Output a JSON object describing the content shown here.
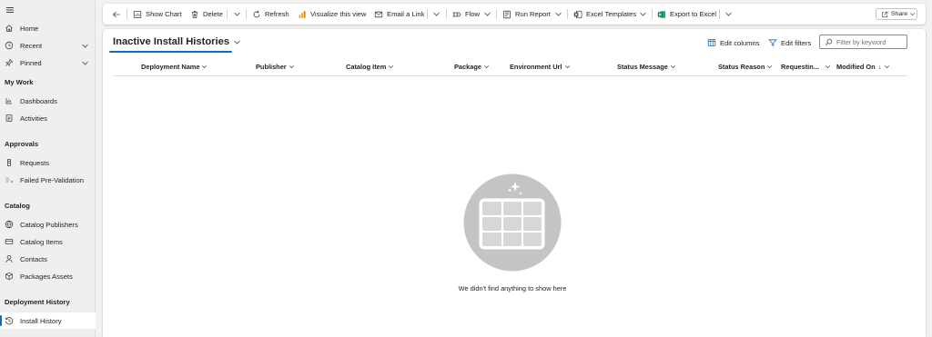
{
  "sidebar": {
    "home": "Home",
    "recent": "Recent",
    "pinned": "Pinned",
    "my_work_header": "My Work",
    "dashboards": "Dashboards",
    "activities": "Activities",
    "approvals_header": "Approvals",
    "requests": "Requests",
    "failed_prevalidation": "Failed Pre-Validation",
    "catalog_header": "Catalog",
    "catalog_publishers": "Catalog Publishers",
    "catalog_items": "Catalog Items",
    "contacts": "Contacts",
    "packages_assets": "Packages Assets",
    "deployment_history_header": "Deployment History",
    "install_history": "Install History"
  },
  "toolbar": {
    "show_chart": "Show Chart",
    "delete": "Delete",
    "refresh": "Refresh",
    "visualize": "Visualize this view",
    "email_link": "Email a Link",
    "flow": "Flow",
    "run_report": "Run Report",
    "excel_templates": "Excel Templates",
    "export_excel": "Export to Excel",
    "share": "Share"
  },
  "view": {
    "title": "Inactive Install Histories",
    "edit_columns": "Edit columns",
    "edit_filters": "Edit filters",
    "search_placeholder": "Filter by keyword",
    "search_value": ""
  },
  "columns": [
    "Deployment Name",
    "Publisher",
    "Catalog Item",
    "Package",
    "Environment Url",
    "Status Message",
    "Status Reason",
    "Requestin...",
    "Modified On"
  ],
  "sort_indicator": "↓",
  "empty_message": "We didn't find anything to show here",
  "colors": {
    "accent": "#0f6cbd",
    "excel_green": "#107c41",
    "visualize_yellow": "#e8a317",
    "empty_circle": "#c4c4c4"
  }
}
